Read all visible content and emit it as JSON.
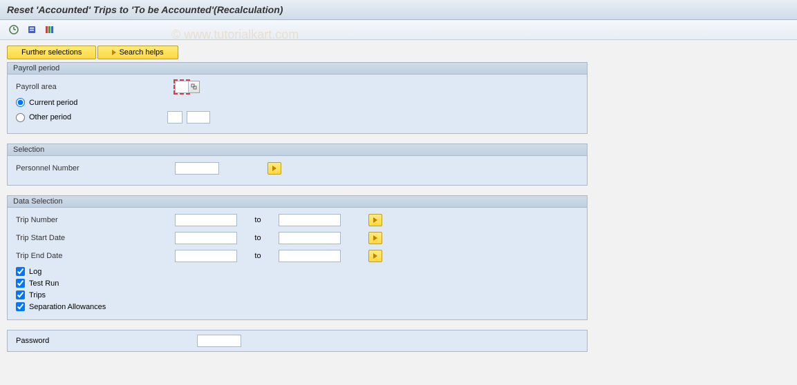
{
  "title": "Reset 'Accounted' Trips to 'To be Accounted'(Recalculation)",
  "watermark": "© www.tutorialkart.com",
  "buttons": {
    "further_selections": "Further selections",
    "search_helps": "Search helps"
  },
  "groups": {
    "payroll": {
      "title": "Payroll period",
      "payroll_area_label": "Payroll area",
      "payroll_area_value": "",
      "current_period_label": "Current period",
      "other_period_label": "Other period",
      "other_period_a": "",
      "other_period_b": ""
    },
    "selection": {
      "title": "Selection",
      "personnel_number_label": "Personnel Number",
      "personnel_number_value": ""
    },
    "data_selection": {
      "title": "Data Selection",
      "to_label": "to",
      "trip_number_label": "Trip Number",
      "trip_number_from": "",
      "trip_number_to": "",
      "trip_start_label": "Trip Start Date",
      "trip_start_from": "",
      "trip_start_to": "",
      "trip_end_label": "Trip End Date",
      "trip_end_from": "",
      "trip_end_to": "",
      "log_label": "Log",
      "test_run_label": "Test Run",
      "trips_label": "Trips",
      "sep_allowances_label": "Separation Allowances"
    },
    "password": {
      "label": "Password",
      "value": ""
    }
  }
}
